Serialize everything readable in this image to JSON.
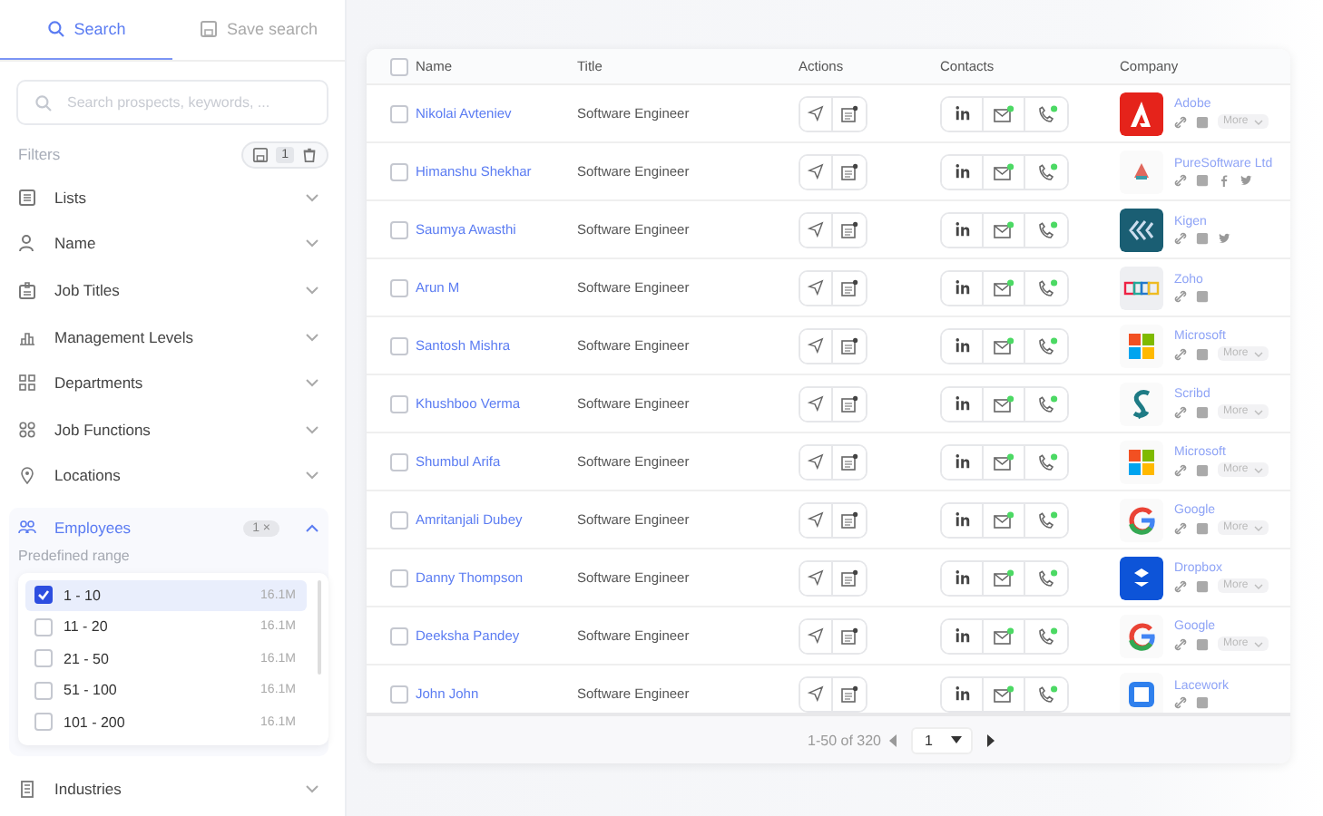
{
  "tabs": [
    {
      "label": "Search",
      "selected": true
    },
    {
      "label": "Save search",
      "selected": false
    }
  ],
  "search": {
    "placeholder": "Search prospects, keywords, ..."
  },
  "filters": {
    "label": "Filters",
    "count": "1",
    "items": [
      {
        "label": "Lists",
        "expanded": false
      },
      {
        "label": "Name",
        "expanded": false
      },
      {
        "label": "Job Titles",
        "expanded": false
      },
      {
        "label": "Management Levels",
        "expanded": false
      },
      {
        "label": "Departments",
        "expanded": false
      },
      {
        "label": "Job Functions",
        "expanded": false
      },
      {
        "label": "Locations",
        "expanded": false
      },
      {
        "label": "Employees",
        "expanded": true,
        "badge": "1 ×",
        "subtitle": "Predefined range",
        "options": [
          {
            "label": "1 - 10",
            "count": "16.1M",
            "checked": true,
            "selected": true
          },
          {
            "label": "11 - 20",
            "count": "16.1M",
            "checked": false,
            "selected": false
          },
          {
            "label": "21 - 50",
            "count": "16.1M",
            "checked": false,
            "selected": false
          },
          {
            "label": "51 - 100",
            "count": "16.1M",
            "checked": false,
            "selected": false
          },
          {
            "label": "101 - 200",
            "count": "16.1M",
            "checked": false,
            "selected": false
          }
        ]
      },
      {
        "label": "Industries",
        "expanded": false
      }
    ]
  },
  "table": {
    "all_checked": false,
    "columns": [
      "Name",
      "Title",
      "Actions",
      "Contacts",
      "Company"
    ],
    "rows": [
      {
        "checked": false,
        "name": "Nikolai Avteniev",
        "title": "Software Engineer",
        "company": {
          "name": "Adobe",
          "kind": "adobe",
          "more": "More"
        }
      },
      {
        "checked": false,
        "name": "Himanshu Shekhar",
        "title": "Software Engineer",
        "company": {
          "name": "PureSoftware Ltd",
          "kind": "pure"
        }
      },
      {
        "checked": false,
        "name": "Saumya Awasthi",
        "title": "Software Engineer",
        "company": {
          "name": "Kigen",
          "kind": "kigen"
        }
      },
      {
        "checked": false,
        "name": "Arun M",
        "title": "Software Engineer",
        "company": {
          "name": "Zoho",
          "kind": "zoho"
        }
      },
      {
        "checked": false,
        "name": "Santosh Mishra",
        "title": "Software Engineer",
        "company": {
          "name": "Microsoft",
          "kind": "microsoft",
          "more": "More"
        }
      },
      {
        "checked": false,
        "name": "Khushboo Verma",
        "title": "Software Engineer",
        "company": {
          "name": "Scribd",
          "kind": "scribd",
          "more": "More"
        }
      },
      {
        "checked": false,
        "name": "Shumbul Arifa",
        "title": "Software Engineer",
        "company": {
          "name": "Microsoft",
          "kind": "microsoft",
          "more": "More"
        }
      },
      {
        "checked": false,
        "name": "Amritanjali Dubey",
        "title": "Software Engineer",
        "company": {
          "name": "Google",
          "kind": "google",
          "more": "More"
        }
      },
      {
        "checked": false,
        "name": "Danny Thompson",
        "title": "Software Engineer",
        "company": {
          "name": "Dropbox",
          "kind": "dropbox",
          "more": "More"
        }
      },
      {
        "checked": false,
        "name": "Deeksha Pandey",
        "title": "Software Engineer",
        "company": {
          "name": "Google",
          "kind": "google",
          "more": "More"
        }
      },
      {
        "checked": false,
        "name": "John John",
        "title": "Software Engineer",
        "company": {
          "name": "Lacework",
          "kind": "lacework"
        }
      }
    ],
    "pagination": {
      "range": "1-50 of 320",
      "page": "1"
    }
  }
}
